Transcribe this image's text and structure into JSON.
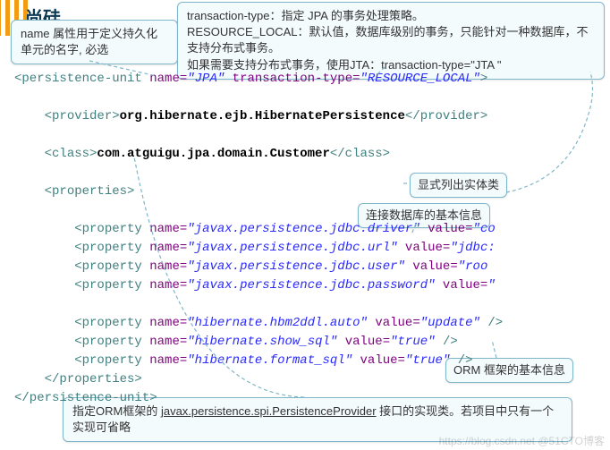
{
  "logo": {
    "text": "尚硅谷"
  },
  "callouts": {
    "name": "name 属性用于定义持久化单元的名字, 必选",
    "tt_l1": "transaction-type：指定 JPA  的事务处理策略。",
    "tt_l2": "RESOURCE_LOCAL：默认值，数据库级别的事务，只能针对一种数据库，不支持分布式事务。",
    "tt_l3": "如果需要支持分布式事务，使用JTA：transaction-type=\"JTA \"",
    "entity": "显式列出实体类",
    "conn": "连接数据库的基本信息",
    "orm": "ORM 框架的基本信息",
    "provider_a": "指定ORM框架的 ",
    "provider_u": "javax.persistence.spi.PersistenceProvider",
    "provider_b": " 接口的实现类。若项目中只有一个实现可省略"
  },
  "code": {
    "pu_open": "<persistence-unit",
    "name_attr": "name=",
    "name_val": "\"JPA\"",
    "tt_attr": "transaction-type=",
    "tt_val": "\"RESOURCE_LOCAL\"",
    "gt": ">",
    "prov_open": "<provider>",
    "prov_txt": "org.hibernate.ejb.HibernatePersistence",
    "prov_close": "</provider>",
    "class_open": "<class>",
    "class_txt": "com.atguigu.jpa.domain.Customer",
    "class_close": "</class>",
    "props_open": "<properties>",
    "prop_open": "<property",
    "value_attr": "value=",
    "p1n": "\"javax.persistence.jdbc.driver\"",
    "p1v": "\"co",
    "p2n": "\"javax.persistence.jdbc.url\"",
    "p2v": "\"jdbc:",
    "p3n": "\"javax.persistence.jdbc.user\"",
    "p3v": "\"roo",
    "p4n": "\"javax.persistence.jdbc.password\"",
    "p4v": "\"",
    "p5n": "\"hibernate.hbm2ddl.auto\"",
    "p5v": "\"update\"",
    "p6n": "\"hibernate.show_sql\"",
    "p6v": "\"true\"",
    "p7n": "\"hibernate.format_sql\"",
    "p7v": "\"true\"",
    "slash_gt": " />",
    "props_close": "</properties>",
    "pu_close": "</persistence-unit>"
  },
  "watermark": "https://blog.csdn.net   @51CTO博客"
}
